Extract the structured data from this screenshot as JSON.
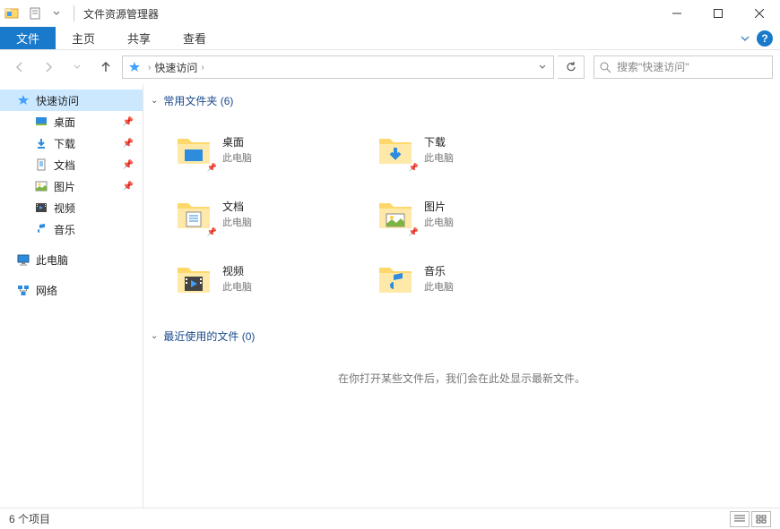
{
  "titlebar": {
    "title": "文件资源管理器"
  },
  "ribbon": {
    "file_tab": "文件",
    "tabs": [
      "主页",
      "共享",
      "查看"
    ]
  },
  "addressbar": {
    "current": "快速访问"
  },
  "search": {
    "placeholder": "搜索\"快速访问\""
  },
  "sidebar": {
    "quick_access": "快速访问",
    "this_pc": "此电脑",
    "network": "网络",
    "items": [
      {
        "label": "桌面"
      },
      {
        "label": "下载"
      },
      {
        "label": "文档"
      },
      {
        "label": "图片"
      },
      {
        "label": "视频"
      },
      {
        "label": "音乐"
      }
    ]
  },
  "content": {
    "frequent_header": "常用文件夹 (6)",
    "recent_header": "最近使用的文件 (0)",
    "empty_recent": "在你打开某些文件后，我们会在此处显示最新文件。",
    "folders": [
      {
        "name": "桌面",
        "location": "此电脑"
      },
      {
        "name": "下载",
        "location": "此电脑"
      },
      {
        "name": "文档",
        "location": "此电脑"
      },
      {
        "name": "图片",
        "location": "此电脑"
      },
      {
        "name": "视频",
        "location": "此电脑"
      },
      {
        "name": "音乐",
        "location": "此电脑"
      }
    ]
  },
  "statusbar": {
    "count": "6 个项目"
  }
}
